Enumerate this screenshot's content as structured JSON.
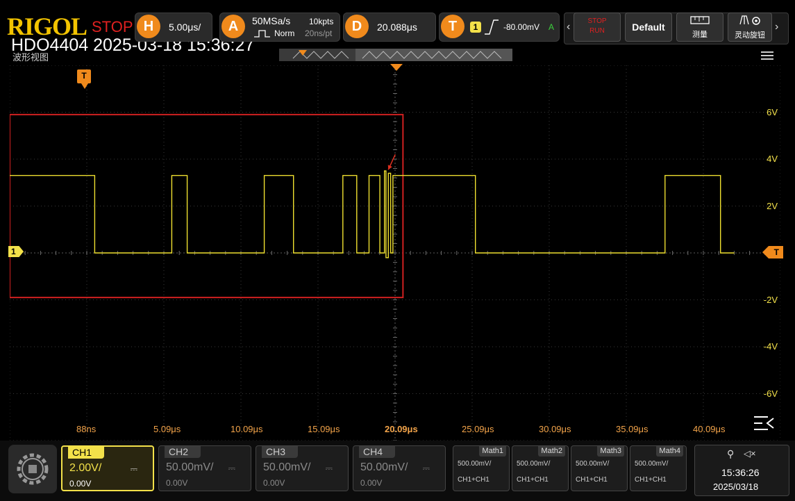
{
  "header": {
    "brand": "RIGOL",
    "run_state": "STOP",
    "model_timestamp": "HDO4404 2025-03-18 15:36:27",
    "view_title": "波形视图"
  },
  "horizontal": {
    "badge": "H",
    "timebase": "5.00μs/"
  },
  "acquire": {
    "badge": "A",
    "sample_rate": "50MSa/s",
    "mode": "Norm",
    "memory_depth": "10kpts",
    "resolution": "20ns/pt"
  },
  "delay": {
    "badge": "D",
    "value": "20.088μs"
  },
  "trigger": {
    "badge": "T",
    "source": "1",
    "level": "-80.00mV",
    "sweep": "A"
  },
  "toolbar": {
    "stop_run_label": "STOP\nRUN",
    "default_label": "Default",
    "measure_label": "测量",
    "knob_label": "灵动旋钮"
  },
  "markers": {
    "trigger_position": "T",
    "trigger_level": "T",
    "ch1_ground": "1"
  },
  "chart_data": {
    "type": "line",
    "title": "",
    "xlabel": "",
    "ylabel": "",
    "x_tick_labels": [
      "88ns",
      "5.09μs",
      "10.09μs",
      "15.09μs",
      "20.09μs",
      "25.09μs",
      "30.09μs",
      "35.09μs",
      "40.09μs"
    ],
    "y_tick_labels": [
      "6V",
      "4V",
      "2V",
      "-2V",
      "-4V",
      "-6V"
    ],
    "x_range_us": [
      -4.912,
      45.088
    ],
    "y_range_v": [
      -8,
      8
    ],
    "grid": true,
    "series": [
      {
        "color": "#f0e030",
        "x_us": [
          -4.912,
          0.6,
          0.6,
          5.6,
          5.6,
          6.6,
          6.6,
          11.6,
          11.6,
          13.5,
          13.5,
          16.7,
          16.7,
          17.6,
          17.6,
          18.4,
          18.4,
          19.1,
          19.1,
          19.4,
          19.4,
          19.5,
          19.5,
          19.65,
          19.65,
          19.8,
          19.8,
          19.95,
          19.95,
          25.3,
          25.3,
          37.6,
          37.6,
          41.2,
          41.2,
          42.1,
          42.1,
          45.088
        ],
        "y_v": [
          3.3,
          3.3,
          0,
          0,
          3.3,
          3.3,
          0,
          0,
          3.3,
          3.3,
          0,
          0,
          3.3,
          3.3,
          0,
          0,
          3.3,
          3.3,
          0,
          0,
          3.5,
          3.5,
          -0.2,
          -0.2,
          3.4,
          3.4,
          0,
          0,
          3.3,
          3.3,
          0,
          0,
          3.3,
          3.3,
          0,
          0
        ]
      }
    ],
    "highlight_box": {
      "color": "#d02020",
      "x_us": [
        -4.912,
        20.6
      ],
      "y_v": [
        -1.9,
        5.9
      ]
    },
    "annotation_arrow": {
      "color": "#e03020",
      "from": [
        20.1,
        4.2
      ],
      "to": [
        19.65,
        3.55
      ]
    }
  },
  "channels": [
    {
      "name": "CH1",
      "scale": "2.00V/",
      "offset": "0.00V",
      "active": true,
      "color": "#f3e14a"
    },
    {
      "name": "CH2",
      "scale": "50.00mV/",
      "offset": "0.00V",
      "active": false,
      "color": "#888888"
    },
    {
      "name": "CH3",
      "scale": "50.00mV/",
      "offset": "0.00V",
      "active": false,
      "color": "#888888"
    },
    {
      "name": "CH4",
      "scale": "50.00mV/",
      "offset": "0.00V",
      "active": false,
      "color": "#888888"
    }
  ],
  "math": [
    {
      "name": "Math1",
      "scale": "500.00mV/",
      "formula": "CH1+CH1"
    },
    {
      "name": "Math2",
      "scale": "500.00mV/",
      "formula": "CH1+CH1"
    },
    {
      "name": "Math3",
      "scale": "500.00mV/",
      "formula": "CH1+CH1"
    },
    {
      "name": "Math4",
      "scale": "500.00mV/",
      "formula": "CH1+CH1"
    }
  ],
  "status": {
    "time": "15:36:26",
    "date": "2025/03/18"
  }
}
